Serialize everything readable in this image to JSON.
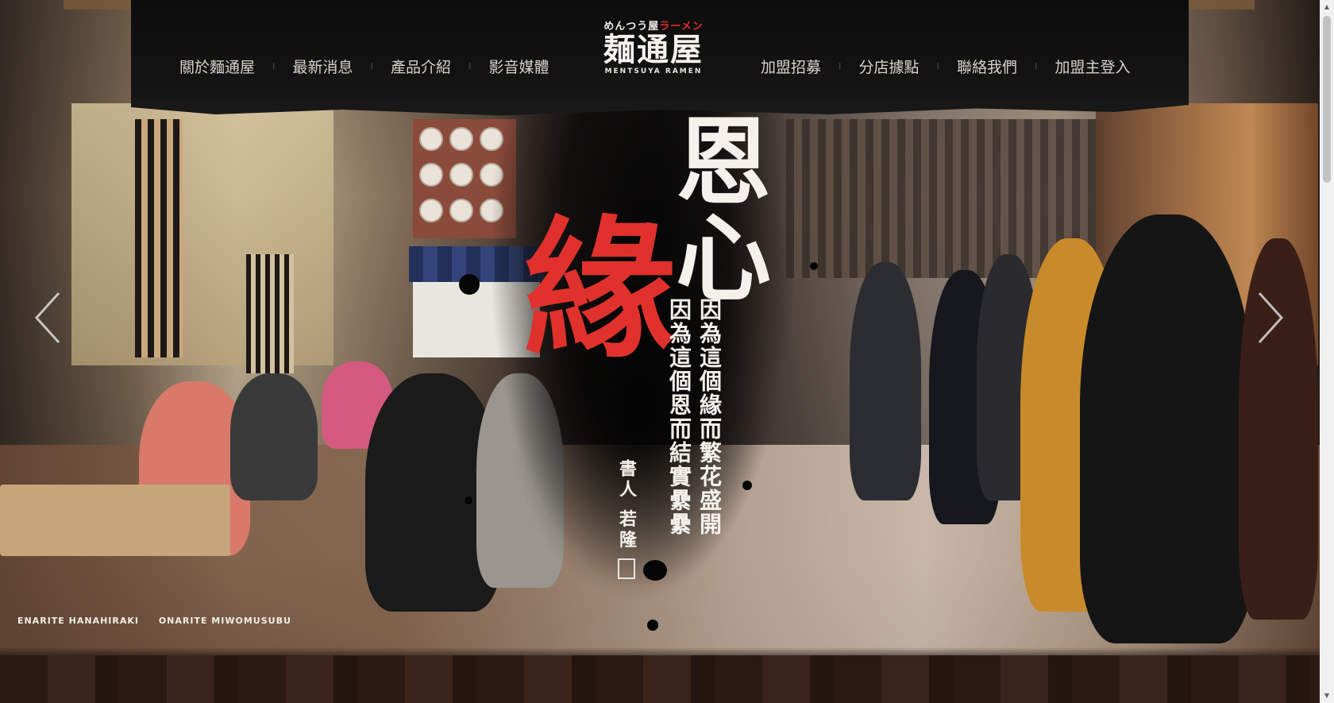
{
  "nav": {
    "left": [
      "關於麵通屋",
      "最新消息",
      "產品介紹",
      "影音媒體"
    ],
    "right": [
      "加盟招募",
      "分店據點",
      "聯絡我們",
      "加盟主登入"
    ],
    "separator": "⁞"
  },
  "logo": {
    "small_prefix": "めんつう屋",
    "small_suffix": "ラーメン",
    "main": "麺通屋",
    "english": "MENTSUYA RAMEN"
  },
  "hero": {
    "calligraphy_white_big": "恩心",
    "calligraphy_red": "緣",
    "poem_col1": "因為這個緣而繁花盛開",
    "poem_col2": "因為這個恩而結實纍纍",
    "signature": "書人 若隆",
    "caption_left": "ENARITE HANAHIRAKI",
    "caption_right": "ONARITE MIWOMUSUBU"
  },
  "carousel": {
    "prev_icon": "chevron-left-icon",
    "next_icon": "chevron-right-icon"
  },
  "colors": {
    "header_bg": "#111111",
    "nav_text": "#d7d2cb",
    "accent_red": "#e0312c"
  }
}
